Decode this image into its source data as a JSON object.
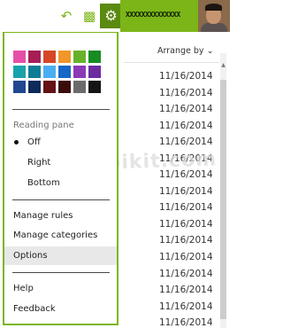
{
  "topbar": {
    "undo_icon": "undo-icon",
    "chat_icon": "chat-icon",
    "settings_icon": "gear-icon",
    "username": "XXXXXXXXXXXXXX",
    "accent": "#7cb518"
  },
  "list": {
    "arrange_label": "Arrange by",
    "dates": [
      "11/16/2014",
      "11/16/2014",
      "11/16/2014",
      "11/16/2014",
      "11/16/2014",
      "11/16/2014",
      "11/16/2014",
      "11/16/2014",
      "11/16/2014",
      "11/16/2014",
      "11/16/2014",
      "11/16/2014",
      "11/16/2014",
      "11/16/2014",
      "11/16/2014",
      "11/16/2014"
    ]
  },
  "menu": {
    "theme_colors": [
      "#e64fa8",
      "#a71d55",
      "#d64726",
      "#f0962a",
      "#68b22b",
      "#178c23",
      "#19a2ac",
      "#0c7d96",
      "#4baef2",
      "#1667c8",
      "#8b39b7",
      "#6d2ba0",
      "#20478f",
      "#0e2a5a",
      "#641317",
      "#3a0d0b",
      "#6b6b6b",
      "#151515"
    ],
    "reading_pane_label": "Reading pane",
    "reading_pane_options": [
      "Off",
      "Right",
      "Bottom"
    ],
    "reading_pane_selected": "Off",
    "manage_rules": "Manage rules",
    "manage_categories": "Manage categories",
    "options": "Options",
    "help": "Help",
    "feedback": "Feedback"
  },
  "watermark": "topikit.com"
}
